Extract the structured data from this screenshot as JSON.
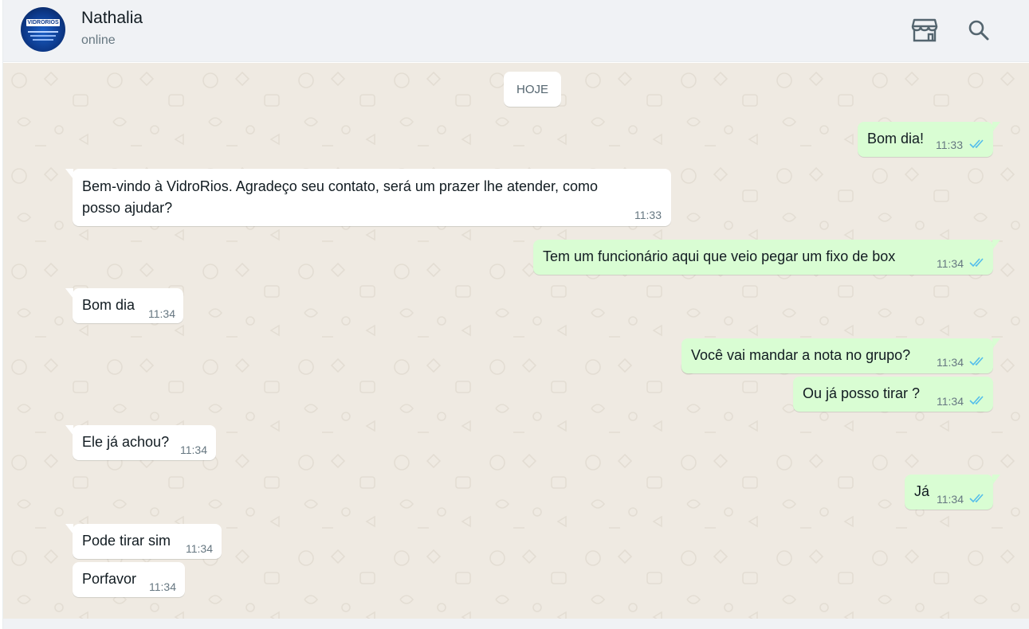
{
  "header": {
    "contact_name": "Nathalia",
    "status": "online",
    "avatar_icon": "vidrorios-logo-avatar",
    "avatar_text": "VIDRORIOS",
    "catalog_icon": "storefront-icon",
    "search_icon": "search-icon"
  },
  "chat": {
    "date_label": "HOJE",
    "messages": [
      {
        "dir": "out",
        "text": "Bom dia!",
        "time": "11:33",
        "read": true
      },
      {
        "dir": "in",
        "text_line1": "Bem-vindo à VidroRios. Agradeço seu contato, será um prazer lhe atender, como",
        "text_line2": "posso ajudar?",
        "time": "11:33"
      },
      {
        "dir": "out",
        "text": "Tem um funcionário aqui que veio pegar um fixo de box",
        "time": "11:34",
        "read": true
      },
      {
        "dir": "in",
        "text": "Bom dia",
        "time": "11:34"
      },
      {
        "dir": "out",
        "text": "Você vai mandar a nota no grupo?",
        "time": "11:34",
        "read": true
      },
      {
        "dir": "out",
        "text": "Ou já posso tirar ?",
        "time": "11:34",
        "read": true
      },
      {
        "dir": "in",
        "text": "Ele já achou?",
        "time": "11:34"
      },
      {
        "dir": "out",
        "text": "Já",
        "time": "11:34",
        "read": true
      },
      {
        "dir": "in",
        "text": "Pode tirar sim",
        "time": "11:34"
      },
      {
        "dir": "in",
        "text": "Porfavor",
        "time": "11:34"
      }
    ]
  },
  "colors": {
    "incoming_bubble": "#ffffff",
    "outgoing_bubble": "#d9fdd3",
    "chat_background": "#efeae2",
    "read_ticks": "#53bdeb",
    "header_background": "#f0f2f5"
  }
}
